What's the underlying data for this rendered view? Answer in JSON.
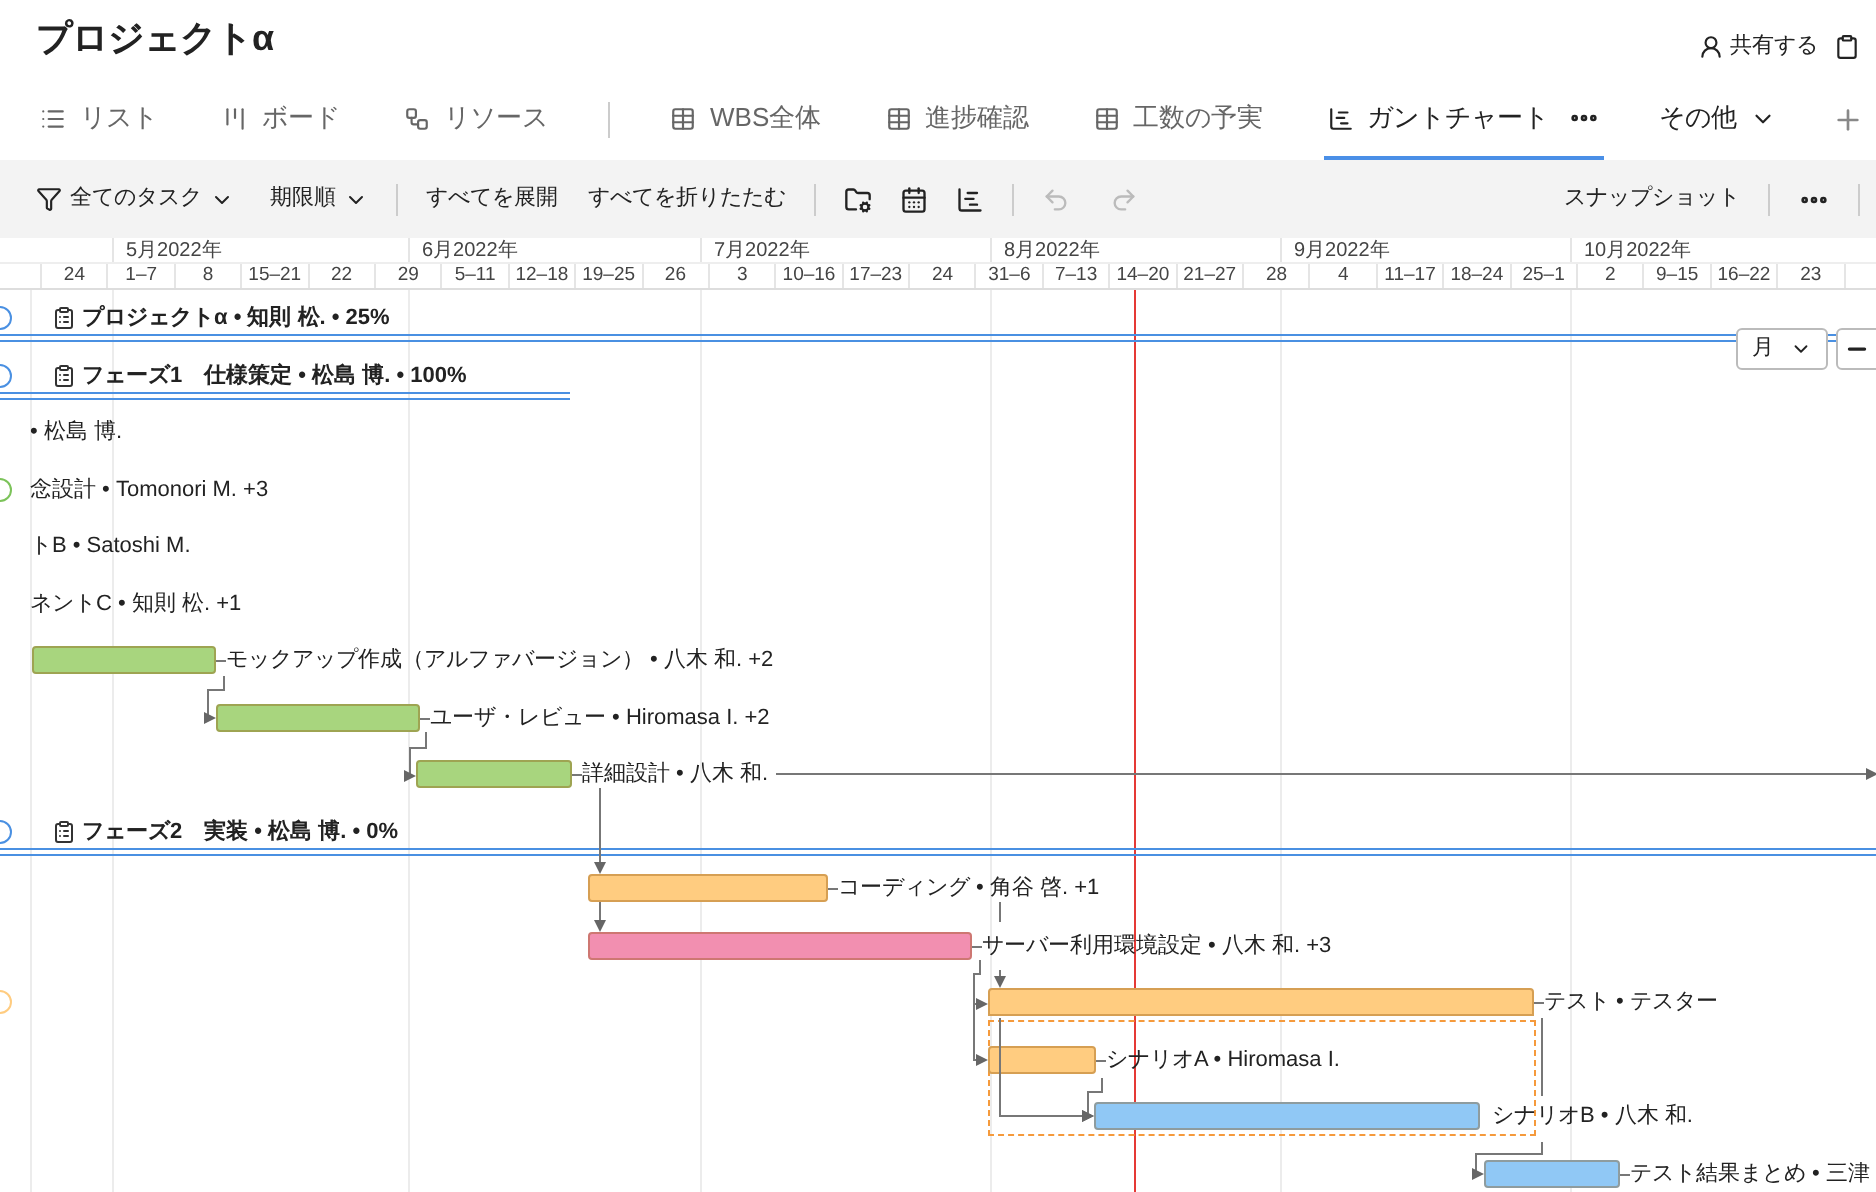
{
  "project": {
    "title": "プロジェクトα",
    "share": "共有する"
  },
  "tabs": [
    {
      "label": "リスト",
      "selected": false
    },
    {
      "label": "ボード",
      "selected": false
    },
    {
      "label": "リソース",
      "selected": false
    },
    {
      "label": "WBS全体",
      "selected": false
    },
    {
      "label": "進捗確認",
      "selected": false
    },
    {
      "label": "工数の予実",
      "selected": false
    },
    {
      "label": "ガントチャート",
      "selected": true
    }
  ],
  "more_tab": "その他",
  "toolbar": {
    "filter": "全てのタスク",
    "sort": "期限順",
    "expand_all": "すべてを展開",
    "collapse_all": "すべてを折りたたむ",
    "undo_disabled": true,
    "redo_disabled": true,
    "snapshot": "スナップショット"
  },
  "timeline": {
    "months": [
      "5月2022年",
      "6月2022年",
      "7月2022年",
      "8月2022年",
      "9月2022年",
      "10月2022年"
    ],
    "weeks": [
      "24",
      "1–7",
      "8",
      "15–21",
      "22",
      "29",
      "5–11",
      "12–18",
      "19–25",
      "26",
      "3",
      "10–16",
      "17–23",
      "24",
      "31–6",
      "7–13",
      "14–20",
      "21–27",
      "28",
      "4",
      "11–17",
      "18–24",
      "25–1",
      "2",
      "9–15",
      "16–22",
      "23"
    ],
    "scale": "月"
  },
  "rows": [
    {
      "kind": "summary",
      "label": "プロジェクトα • 知則 松. • 25%",
      "color": "#4a90e2",
      "marker": true
    },
    {
      "kind": "summary",
      "label": "フェーズ1　仕様策定 • 松島 博. • 100%",
      "color": "#4a90e2",
      "marker": true
    },
    {
      "kind": "label",
      "label": "• 松島 博.",
      "marker": false
    },
    {
      "kind": "label",
      "label": "念設計 • Tomonori M. +3",
      "color": "#7cc35a",
      "marker": true
    },
    {
      "kind": "label",
      "label": "トB • Satoshi M.",
      "marker": false
    },
    {
      "kind": "label",
      "label": "ネントC • 知則 松. +1",
      "marker": false
    },
    {
      "kind": "bar",
      "label": "モックアップ作成（アルファバージョン） • 八木 和. +2",
      "color": "#a8d57e",
      "marker": false
    },
    {
      "kind": "bar",
      "label": "ユーザ・レビュー • Hiromasa I. +2",
      "color": "#a8d57e",
      "marker": false
    },
    {
      "kind": "bar",
      "label": "詳細設計 • 八木 和.",
      "color": "#a8d57e",
      "marker": false
    },
    {
      "kind": "summary",
      "label": "フェーズ2　実装 • 松島 博. • 0%",
      "color": "#4a90e2",
      "marker": true
    },
    {
      "kind": "bar",
      "label": "コーディング • 角谷 啓. +1",
      "color": "#ffcc80",
      "marker": false
    },
    {
      "kind": "bar",
      "label": "サーバー利用環境設定 • 八木 和. +3",
      "color": "#f28fb0",
      "marker": false
    },
    {
      "kind": "group_bar",
      "label": "テスト • テスター",
      "color": "#ffcc80",
      "marker": true
    },
    {
      "kind": "bar",
      "label": "シナリオA • Hiromasa I.",
      "color": "#ffcc80",
      "marker": false
    },
    {
      "kind": "bar",
      "label": "シナリオB • 八木 和.",
      "color": "#90c8f5",
      "marker": false
    },
    {
      "kind": "bar",
      "label": "テスト結果まとめ • 三津",
      "color": "#90c8f5",
      "marker": false
    }
  ]
}
